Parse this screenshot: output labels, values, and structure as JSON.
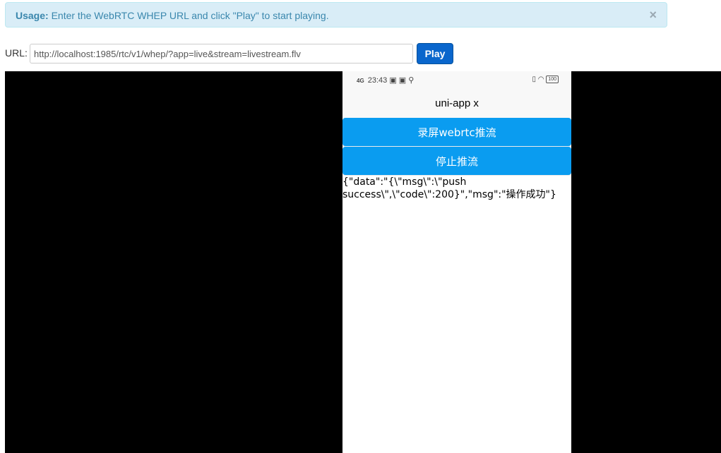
{
  "alert": {
    "label": "Usage:",
    "text": " Enter the WebRTC WHEP URL and click \"Play\" to start playing.",
    "close": "×"
  },
  "url": {
    "label": "URL:",
    "value": "http://localhost:1985/rtc/v1/whep/?app=live&stream=livestream.flv"
  },
  "play_button": "Play",
  "phone": {
    "status": {
      "signal": "4G",
      "time": "23:43",
      "icons_left": "▣ ▣ ⚲",
      "icons_right": "▯ ◠",
      "battery": "100"
    },
    "title": "uni-app x",
    "buttons": [
      "录屏webrtc推流",
      "停止推流"
    ],
    "result": "{\"data\":\"{\\\"msg\\\":\\\"push success\\\",\\\"code\\\":200}\",\"msg\":\"操作成功\"}"
  },
  "colors": {
    "alert_bg": "#d9edf7",
    "alert_text": "#3a87ad",
    "play_bg": "#0a66cc",
    "app_button_bg": "#0a9cf0",
    "video_bg": "#000000"
  }
}
